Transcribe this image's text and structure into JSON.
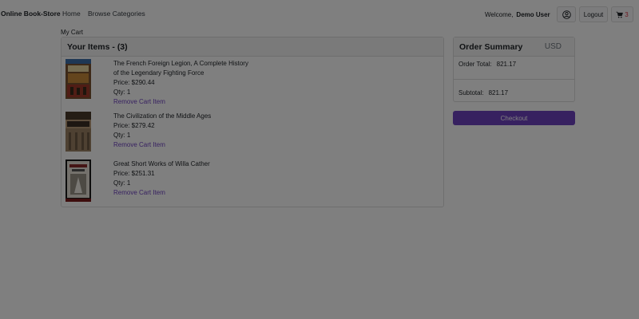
{
  "navbar": {
    "brand": "Online Book-Store",
    "links": [
      "Home",
      "Browse Categories"
    ],
    "welcome_label": "Welcome,",
    "user_name": "Demo User",
    "logout_label": "Logout",
    "cart_count": "3"
  },
  "breadcrumb": "My Cart",
  "items_panel": {
    "title": "Your Items - (3)",
    "remove_label": "Remove Cart Item",
    "items": [
      {
        "title_line1": "The French Foreign Legion, A Complete History",
        "title_line2": "of the Legendary Fighting Force",
        "price": "Price:  $290.44",
        "qty": "Qty: 1"
      },
      {
        "title_line1": "The Civilization of the Middle Ages",
        "price": "Price:  $279.42",
        "qty": "Qty: 1"
      },
      {
        "title_line1": "Great Short Works of Willa Cather",
        "price": "Price:  $251.31",
        "qty": "Qty: 1"
      }
    ]
  },
  "summary": {
    "title": "Order Summary",
    "currency": "USD",
    "order_total_label": "Order Total:",
    "order_total_value": "821.17",
    "subtotal_label": "Subtotal:",
    "subtotal_value": "821.17",
    "checkout_label": "Checkout"
  },
  "colors": {
    "accent": "#6f42c1",
    "cart_badge": "#dc3545",
    "overlay": "rgba(0,0,0,0.5)"
  }
}
